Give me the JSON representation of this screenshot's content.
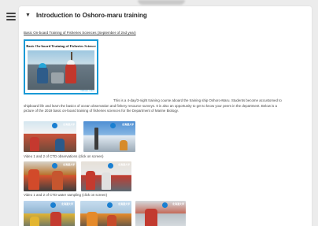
{
  "section": {
    "title": "Introduction to Oshoro-maru training",
    "expand_icon": "chevron-down-icon"
  },
  "sidebar": {
    "toggle_icon": "list-icon"
  },
  "subtitle": "Basic On-board Training of Fisheries Sciences  (September of 2nd year)",
  "hero": {
    "title": "Basic On-board Training of Fisheries Science",
    "caption": "Oshoro-maru",
    "accent_color": "#1a9ad6"
  },
  "description": {
    "line1": "This is a 4-day/3-night training course aboard the training ship Oshoro-Maru. Students become accustomed to",
    "line2": "shipboard life and learn the basics of ocean observation and fishery resource surveys. It is also an opportunity to get to know your peers in the department. Below is a",
    "line3": "picture of the 2019 basic on-board training of fisheries sciences for the Department of Marine Biology."
  },
  "videos": {
    "row1_caption": "Video 1 and 2 of CTD observations (click on screen)",
    "row2_caption": "Video 1 and 2 of CTD water sampling (click on screen)",
    "brand_label": "北海道大学"
  }
}
